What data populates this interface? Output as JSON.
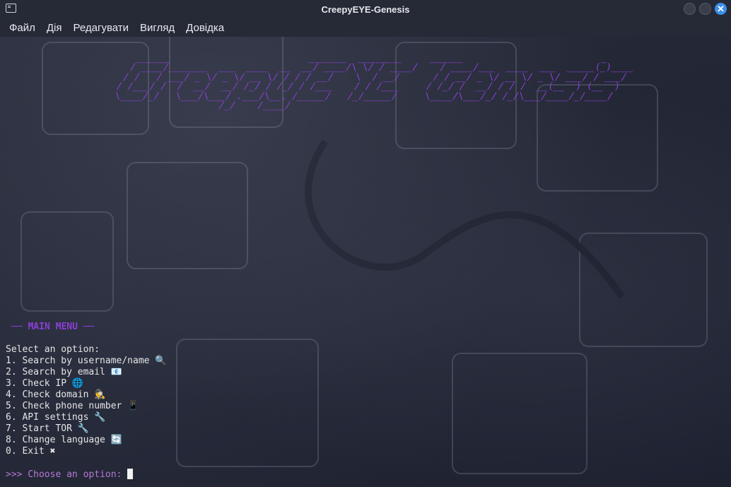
{
  "window": {
    "title": "CreepyEYE-Genesis",
    "close_glyph": "✕"
  },
  "menubar": {
    "items": [
      "Файл",
      "Дія",
      "Редагувати",
      "Вигляд",
      "Довідка"
    ]
  },
  "terminal": {
    "banner": "      ______                         _______  ________     ______                         _\n     / ____/_______  ___  ____  __  __/ ____/\\ \\/ / ____/    / ____/___  ____  ___  _____(_)____\n    / /   / ___/ _ \\/ _ \\/ __ \\/ / / / __/    \\  / __/      / / __/ _ \\/ __ \\/ _ \\/ ___/ / ___/\n   / /___/ /  /  __/  __/ /_/ / /_/ / /___    / / /___     / /_/ /  __/ / / /  __(__  ) (__  )\n   \\____/_/   \\___/\\___/ .___/\\__, /_____/   /_/_____/     \\____/\\___/_/ /_/\\___/____/_/____/\n                      /_/    /____/",
    "menu_header": "── MAIN MENU ──",
    "prompt_line": "Select an option:",
    "options": [
      "1. Search by username/name 🔍",
      "2. Search by email 📧",
      "3. Check IP 🌐",
      "4. Check domain 🕵",
      "5. Check phone number 📱",
      "6. API settings 🔧",
      "7. Start TOR 🔧",
      "8. Change language 🔄",
      "0. Exit ✖"
    ],
    "input_prompt": ">>> Choose an option: ",
    "colors": {
      "accent": "#8a3fd6",
      "prompt": "#b678d6",
      "text": "#e6e6e6"
    }
  }
}
